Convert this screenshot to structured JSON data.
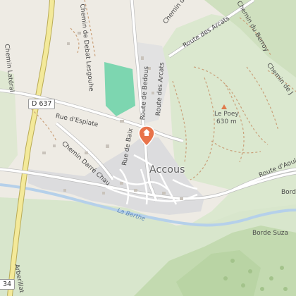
{
  "map": {
    "colors": {
      "land": "#eeebe4",
      "meadow": "#dbe8cf",
      "forest": "#c8ddb4",
      "park": "#7dd6b0",
      "village": "#dcdcde",
      "river": "#b5d0ea",
      "highway": "#f3e99a",
      "highway_edge": "#b9ab56",
      "road": "#ffffff",
      "road_edge": "#bdbdbd",
      "pin": "#e8734a"
    },
    "labels": {
      "chemin_de_debat_lesgouhe": "Chemin de Debat Lesgouhe",
      "chemin_lateral": "Chemin Latéral",
      "chemin_de_j": "Chemin de J",
      "chemin_du_berroy": "Chemin du Berroy",
      "route_des_arcats_top": "Route des Arcats",
      "route_des_arcats_vertical": "Route des Arcats",
      "route_de_bedous": "Route de Bedous",
      "chemin_de_j_right": "Chemin de J",
      "rue_d_espiate": "Rue d'Espiate",
      "chemin_darre_chau": "Chemin Darré Chau",
      "rue_de_baix": "Rue de Baix",
      "route_d_aoulet": "Route d'Aoulet",
      "town": "Accous",
      "river": "La Berthe",
      "borde": "Borde",
      "borde_suza": "Borde Suza",
      "arberillat": "Arberillat",
      "peak_name": "Le Poey",
      "peak_elevation": "630 m"
    },
    "shields": {
      "d637": "D 637",
      "edge_34": "34"
    },
    "icons": {
      "peak": "peak-triangle-icon",
      "pin": "map-pin-icon"
    }
  }
}
